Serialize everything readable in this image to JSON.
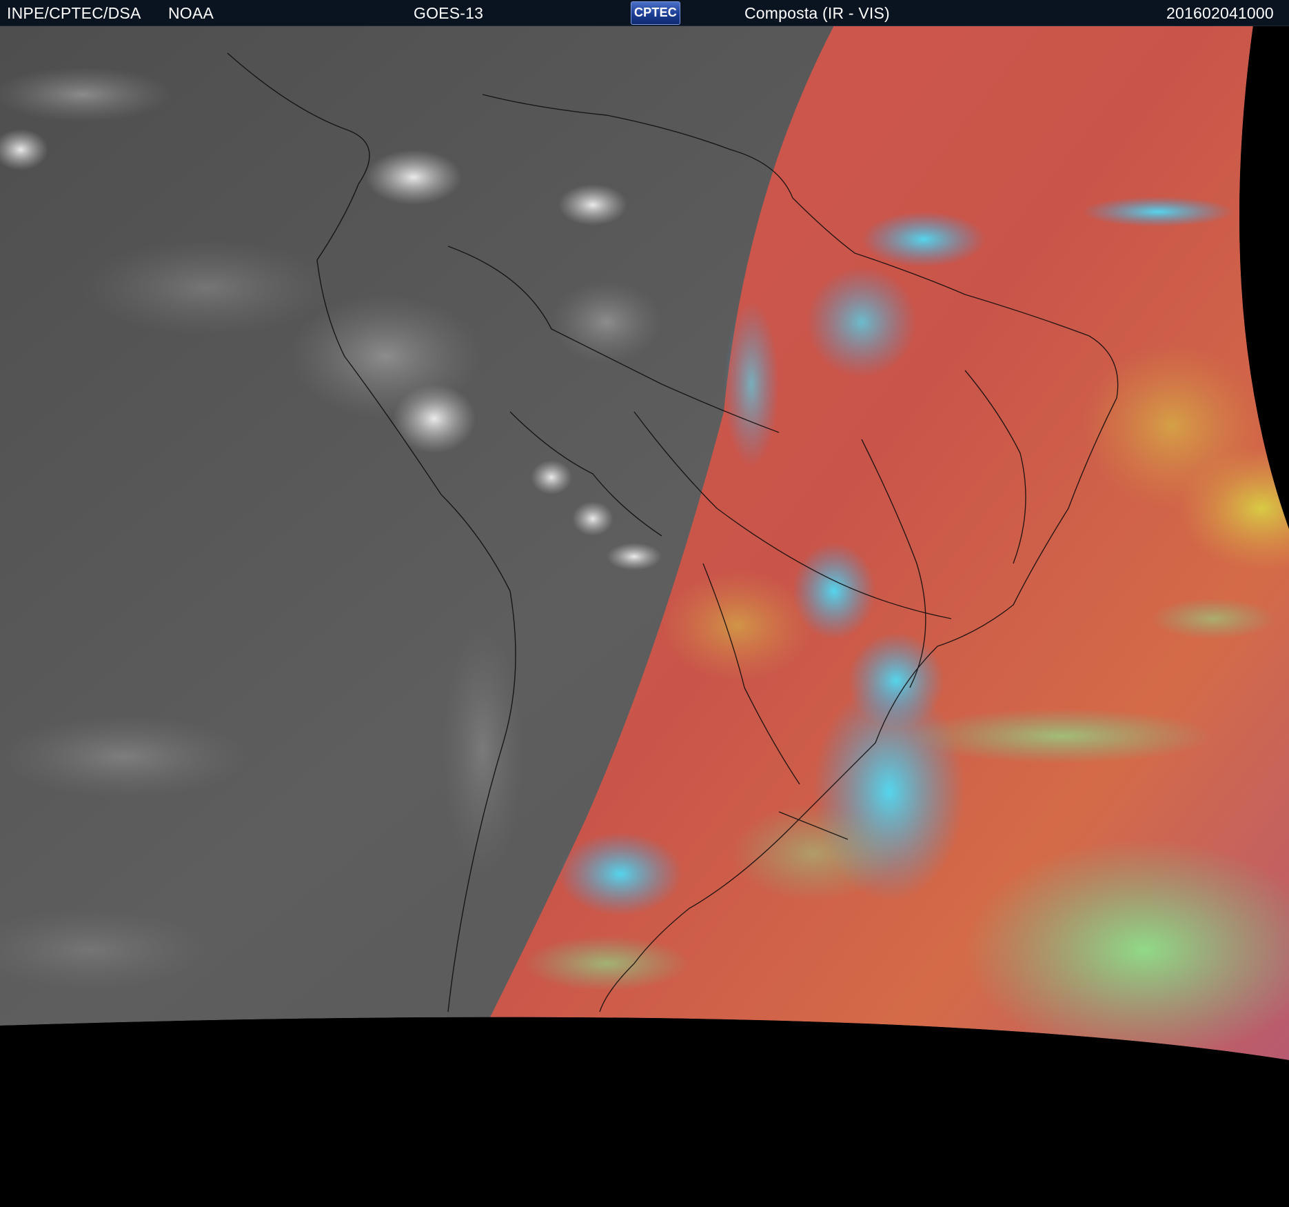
{
  "header": {
    "agency": "INPE/CPTEC/DSA",
    "partner": "NOAA",
    "satellite": "GOES-13",
    "logo_text": "CPTEC",
    "product": "Composta (IR - VIS)",
    "timestamp": "201602041000"
  },
  "colors": {
    "header_bg": "#0a1320",
    "night_side": "#5a5a5a",
    "day_side_base": "#c95448",
    "cloud_cyan": "#43d2f0",
    "cloud_green": "#7fe08a",
    "space": "#000000"
  }
}
